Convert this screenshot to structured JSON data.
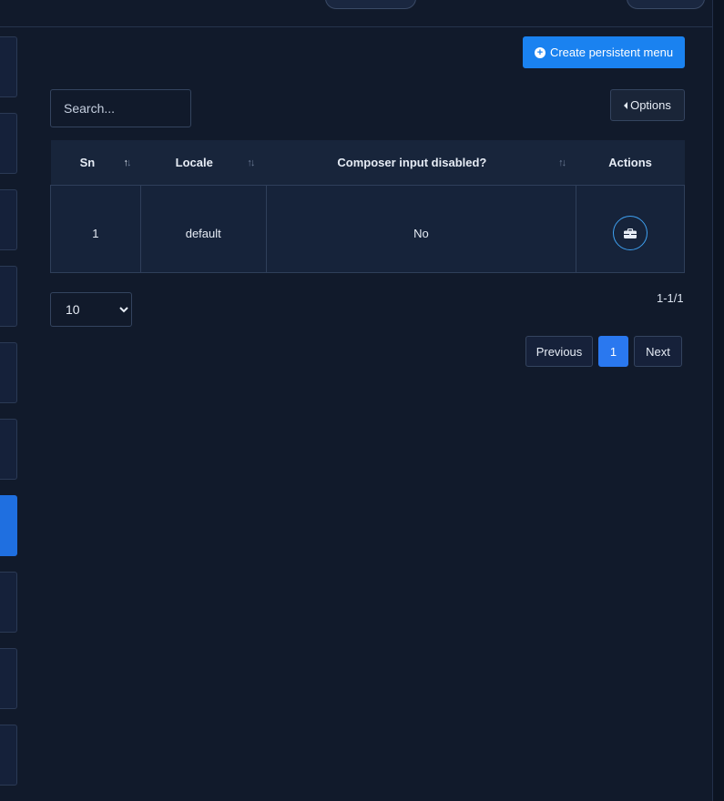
{
  "toolbar": {
    "create_label": "Create persistent menu",
    "options_label": "Options"
  },
  "search": {
    "placeholder": "Search..."
  },
  "table": {
    "columns": [
      "Sn",
      "Locale",
      "Composer input disabled?",
      "Actions"
    ],
    "rows": [
      {
        "sn": "1",
        "locale": "default",
        "composer_input_disabled": "No"
      }
    ]
  },
  "pagination": {
    "page_size": "10",
    "page_size_options": [
      "10"
    ],
    "range": "1-1/1",
    "previous_label": "Previous",
    "current_page": "1",
    "next_label": "Next"
  },
  "sidebar": {
    "active_index": 6,
    "count": 10
  },
  "colors": {
    "background": "#111a2b",
    "accent": "#1a82f0",
    "active_page": "#2a78ef"
  }
}
